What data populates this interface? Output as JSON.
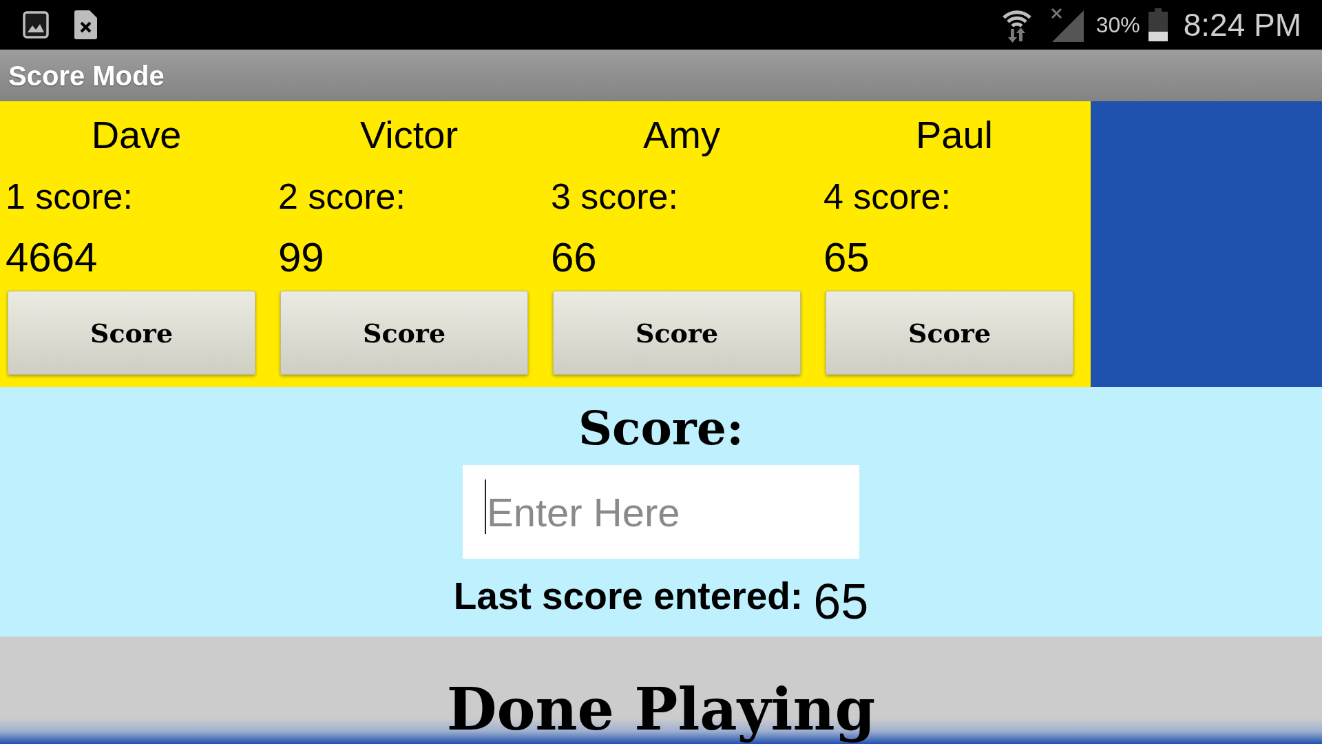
{
  "status_bar": {
    "battery_percent": "30%",
    "time": "8:24 PM"
  },
  "title_bar": {
    "title": "Score Mode"
  },
  "players": [
    {
      "name": "Dave",
      "score_label": "1 score:",
      "score": "4664",
      "button": "Score"
    },
    {
      "name": "Victor",
      "score_label": "2 score:",
      "score": "99",
      "button": "Score"
    },
    {
      "name": "Amy",
      "score_label": "3 score:",
      "score": "66",
      "button": "Score"
    },
    {
      "name": "Paul",
      "score_label": "4 score:",
      "score": "65",
      "button": "Score"
    }
  ],
  "score_entry": {
    "heading": "Score:",
    "input": {
      "placeholder": "Enter Here",
      "focused": true
    },
    "last_score_label": "Last score entered:",
    "last_score": "65"
  },
  "done_button": {
    "label": "Done Playing"
  }
}
